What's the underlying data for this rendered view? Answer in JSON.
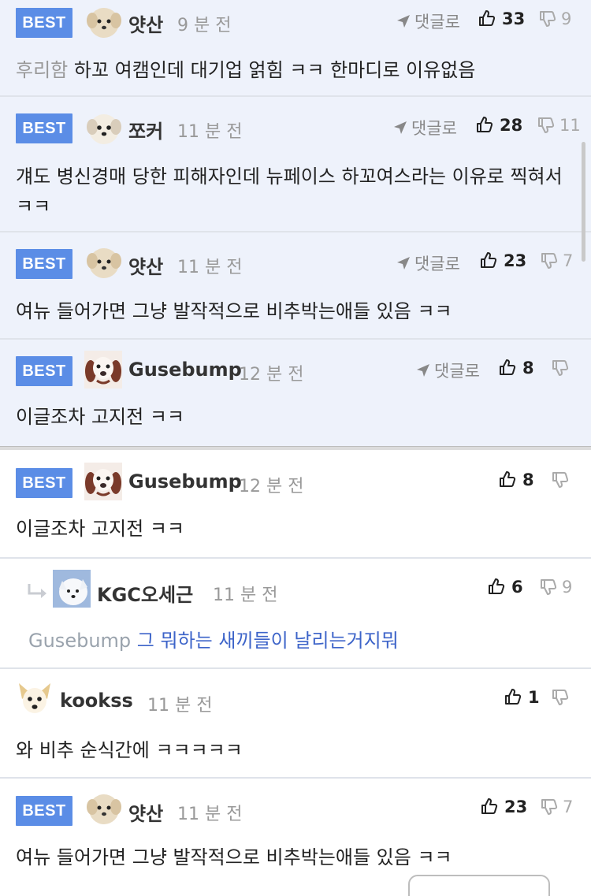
{
  "colors": {
    "best_badge": "#5b8de6",
    "best_background": "#eef2fb",
    "link": "#3d64c9"
  },
  "best_label": "BEST",
  "reply_label": "댓글로",
  "comments": [
    {
      "nick": "얏산",
      "time": "9 분 전",
      "up": "33",
      "down": "9",
      "prefix": "후리함",
      "text": "하꼬 여캠인데 대기업 얽힘 ㅋㅋ 한마디로 이유없음"
    },
    {
      "nick": "쪼커",
      "time": "11 분 전",
      "up": "28",
      "down": "11",
      "text": "걔도 병신경매 당한 피해자인데 뉴페이스 하꼬여스라는 이유로 찍혀서 ㅋㅋ"
    },
    {
      "nick": "얏산",
      "time": "11 분 전",
      "up": "23",
      "down": "7",
      "text": "여뉴 들어가면 그냥 발작적으로 비추박는애들 있음 ㅋㅋ"
    },
    {
      "nick": "Gusebump",
      "time": "12 분 전",
      "up": "8",
      "down": "",
      "text": "이글조차 고지전 ㅋㅋ"
    },
    {
      "nick": "Gusebump",
      "time": "12 분 전",
      "up": "8",
      "down": "",
      "text": "이글조차 고지전 ㅋㅋ"
    },
    {
      "nick": "KGC오세근",
      "time": "11 분 전",
      "up": "6",
      "down": "9",
      "mention": "Gusebump",
      "text": "그 뭐하는 새끼들이 날리는거지뭐"
    },
    {
      "nick": "kookss",
      "time": "11 분 전",
      "up": "1",
      "down": "",
      "text": "와 비추 순식간에 ㅋㅋㅋㅋㅋ"
    },
    {
      "nick": "얏산",
      "time": "11 분 전",
      "up": "23",
      "down": "7",
      "text": "여뉴 들어가면 그냥 발작적으로 비추박는애들 있음 ㅋㅋ"
    }
  ]
}
